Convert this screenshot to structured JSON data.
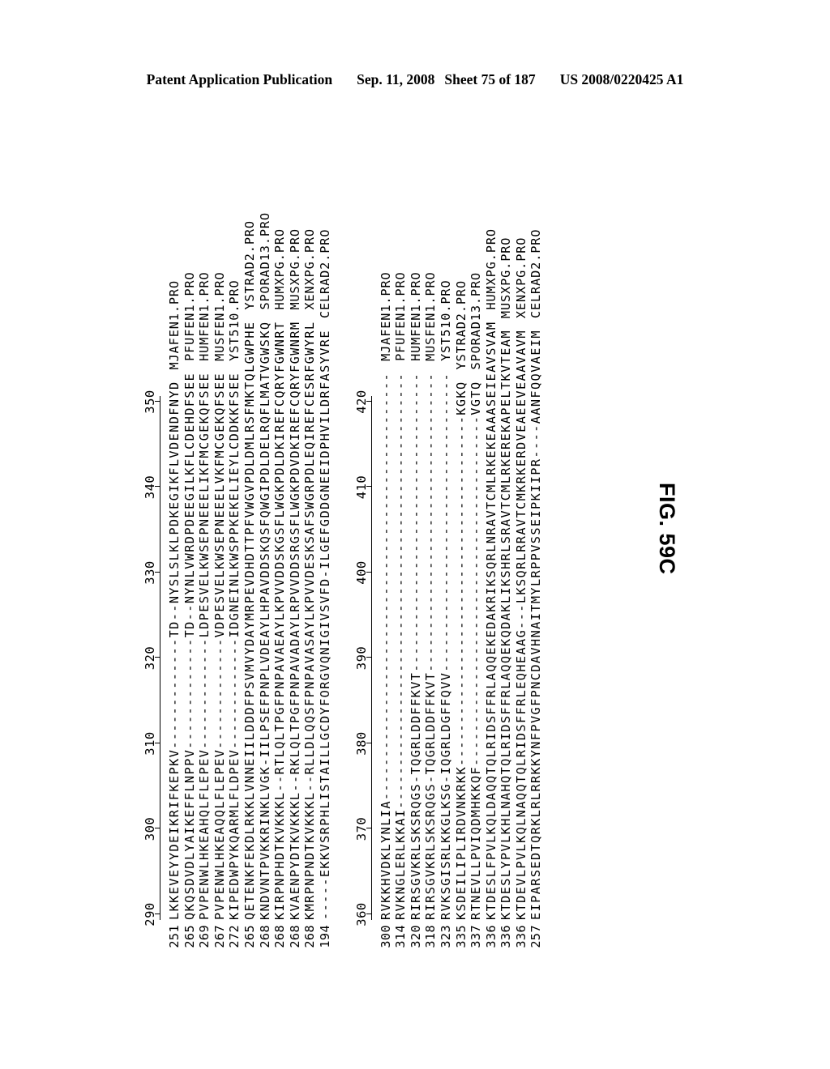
{
  "header": {
    "publication": "Patent Application Publication",
    "date": "Sep. 11, 2008",
    "sheet": "Sheet 75 of 187",
    "patent_number": "US 2008/0220425 A1"
  },
  "figure": {
    "caption": "FIG. 59C"
  },
  "alignment": {
    "blocks": [
      {
        "id": "block-1",
        "ruler": {
          "ticks": [
            290,
            300,
            310,
            320,
            330,
            340,
            350
          ],
          "start": 290,
          "end": 350,
          "step": 10
        },
        "rows": [
          {
            "position": "251",
            "sequence": "LKKEVEYYDEIKRIFKEPKV-------------TD--NYSLSLKLPDKEGIKFLVDENDFNYD",
            "name": "MJAFEN1.PRO"
          },
          {
            "position": "265",
            "sequence": "QKQSDVDLYAIKEFFLNPPV-------------TD--NYNLVWRDPDEEGILKFLCDEHDFSEE",
            "name": "PFUFEN1.PRO"
          },
          {
            "position": "269",
            "sequence": "PVPENWLHKEAHQLFLEPEV-------------LDPESVELKWSEPNEEELIKFMCGEKQFSEE",
            "name": "HUMFEN1.PRO"
          },
          {
            "position": "267",
            "sequence": "PVPENWLHKEAQQLFLEPEV-------------VDPESVELKWSEPNEEELVKFMCGEKQFSEE",
            "name": "MUSFEN1.PRO"
          },
          {
            "position": "272",
            "sequence": "KIPEDWPYKQARMLFLDPEV-------------IDGNEINLKWSPPKEKELIEYLCDDKKFSEE",
            "name": "YST510.PRO"
          },
          {
            "position": "265",
            "sequence": "QETENKFEKDLRKKLVNNEIILDDDFPSVMVYDAYMRPEVDHDTTPFVWGVPDLDMLRSFMKTQLGWPHE",
            "name": "YSTRAD2.PRO"
          },
          {
            "position": "268",
            "sequence": "KNDVNTPVKKRINKLVGK-IILPSEFPNPLVDEAYLHPAVDDSKQSFQWGIPDLDELRQFLMATVGWSKQ",
            "name": "SPORAD13.PRO"
          },
          {
            "position": "268",
            "sequence": "KIRPNPHDTKVKKKL--RTLQLTPGFPNPAVAEAYLKPVVDDSKGSFLWGKPDLDKIREFCQRYFGWNRT",
            "name": "HUMXPG.PRO"
          },
          {
            "position": "268",
            "sequence": "KVAENPYDTKVKKKL--RKLQLTPGFPNPAVADAYLRPVVDDSRGSFLWGKPDVDKIREFCQRYFGWNRM",
            "name": "MUSXPG.PRO"
          },
          {
            "position": "268",
            "sequence": "KMRPNPNDTKVKKKL--RLLDLQQSFPNPAVASAYLKPVVDESKSAFSWGRPDLEQIREFCESRFGWYRL",
            "name": "XENXPG.PRO"
          },
          {
            "position": "194",
            "sequence": "-----EKKVSRPHLISTAILLGCDYFORGVQNIGIVSVFD-ILGEFGDDGNEEIDPHVILDRFASYVRE",
            "name": "CELRAD2.PRO"
          }
        ]
      },
      {
        "id": "block-2",
        "ruler": {
          "ticks": [
            360,
            370,
            380,
            390,
            400,
            410,
            420
          ],
          "start": 360,
          "end": 420,
          "step": 10
        },
        "rows": [
          {
            "position": "300",
            "sequence": "RVKKHVDKLYNLIA--------------------------------------------------",
            "name": "MJAFEN1.PRO"
          },
          {
            "position": "314",
            "sequence": "RVKNGLERLKKAI---------------------------------------------------",
            "name": "PFUFEN1.PRO"
          },
          {
            "position": "320",
            "sequence": "RIRSGVKRLSKSRQGS-TQGRLDDFFKVT-----------------------------------",
            "name": "HUMFEN1.PRO"
          },
          {
            "position": "318",
            "sequence": "RIRSGVKRLSKSRQGS-TQGRLDDFFKVT-----------------------------------",
            "name": "MUSFEN1.PRO"
          },
          {
            "position": "323",
            "sequence": "RVKSGISRLKKGLKSG-IQGRLDGFFQVV-----------------------------------",
            "name": "YST510.PRO"
          },
          {
            "position": "335",
            "sequence": "KSDEILIPLIRDVNKRKK-----------------------------------------KGKQ",
            "name": "YSTRAD2.PRO"
          },
          {
            "position": "337",
            "sequence": "RTNEVLLPVIQDMHKKQF-----------------------------------------VGTQ",
            "name": "SPORAD13.PRO"
          },
          {
            "position": "336",
            "sequence": "KTDESLFPVLKQLDAQQTQLRIDSFFRLAQQEKEDAKRIKSQRLNRAVTCMLRKEKEAAASEIEAVSVAM",
            "name": "HUMXPG.PRO"
          },
          {
            "position": "336",
            "sequence": "KTDESLYPVLKHLNAHQTQLRIDSFFRLAQQEKQDAKLIKSHRLSRAVTCMLRKEREKAPELTKVTEAM",
            "name": "MUSXPG.PRO"
          },
          {
            "position": "336",
            "sequence": "KTDEVLPVLKQLNAQQTQLRIDSFFRLEQHEAAG---LKSQRLRRAVTCMKRKERDVEAEEVEAAVAVM",
            "name": "XENXPG.PRO"
          },
          {
            "position": "257",
            "sequence": "EIPARSEDTQRKLRLRRKKYNFPVGFPNCDAVHNAITMYLRPPVSSEIPKIIPR----AANFQQVAEIM",
            "name": "CELRAD2.PRO"
          }
        ]
      }
    ]
  }
}
